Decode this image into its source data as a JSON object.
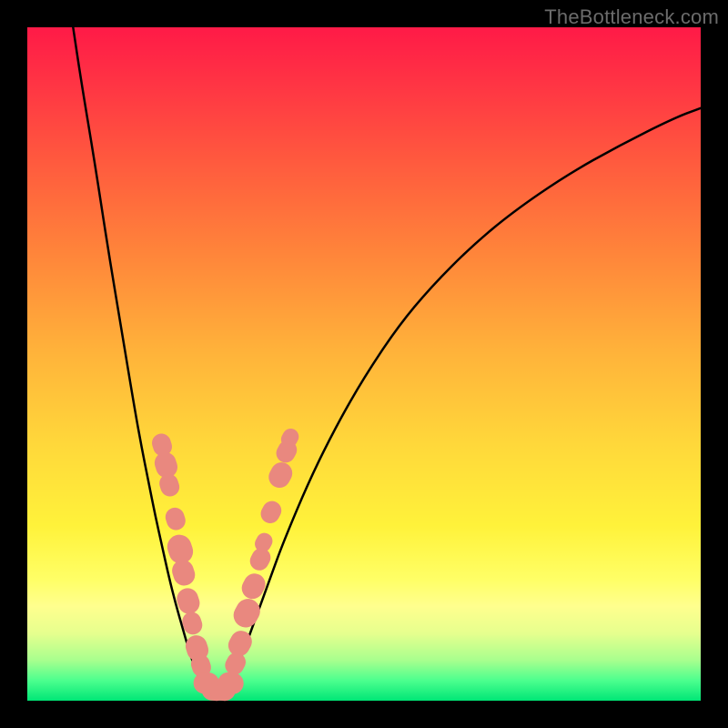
{
  "watermark": "TheBottleneck.com",
  "colors": {
    "frame": "#000000",
    "curve": "#000000",
    "marker": "#e9887f",
    "gradient_stops": [
      "#ff1a47",
      "#ff3344",
      "#ff5a3e",
      "#ff863a",
      "#ffb23a",
      "#ffd83a",
      "#fff23a",
      "#ffff66",
      "#ffff8e",
      "#e6ff8e",
      "#a8ff8e",
      "#4cff8e",
      "#00e676"
    ]
  },
  "chart_data": {
    "type": "line",
    "title": "",
    "xlabel": "",
    "ylabel": "",
    "xlim": [
      0,
      100
    ],
    "ylim": [
      0,
      100
    ],
    "grid": false,
    "legend": false,
    "series": [
      {
        "name": "left-branch",
        "x": [
          6.8,
          8,
          10,
          12,
          14,
          16,
          17,
          18,
          19,
          20,
          21,
          22,
          23,
          24,
          25,
          26
        ],
        "y": [
          100,
          92,
          80,
          67,
          55,
          43,
          37.5,
          32.5,
          27.5,
          23,
          18.5,
          14.5,
          11,
          7.5,
          4.5,
          2.2
        ]
      },
      {
        "name": "valley-floor",
        "x": [
          26,
          27,
          28,
          29,
          30
        ],
        "y": [
          2.2,
          1.2,
          0.8,
          1.2,
          2.2
        ]
      },
      {
        "name": "right-branch",
        "x": [
          30,
          32,
          34,
          36,
          38,
          42,
          46,
          50,
          55,
          60,
          66,
          72,
          80,
          88,
          96,
          100
        ],
        "y": [
          2.2,
          7,
          12.5,
          18,
          23.5,
          33,
          41,
          48,
          55.5,
          61.5,
          67.5,
          72.5,
          78,
          82.5,
          86.5,
          88
        ]
      }
    ],
    "markers_left": [
      {
        "x": 20.0,
        "y": 38.0,
        "r": 1.4
      },
      {
        "x": 20.6,
        "y": 35.0,
        "r": 1.6
      },
      {
        "x": 21.1,
        "y": 32.0,
        "r": 1.4
      },
      {
        "x": 22.0,
        "y": 27.0,
        "r": 1.4
      },
      {
        "x": 22.7,
        "y": 22.5,
        "r": 1.8
      },
      {
        "x": 23.2,
        "y": 19.0,
        "r": 1.6
      },
      {
        "x": 23.9,
        "y": 14.8,
        "r": 1.6
      },
      {
        "x": 24.5,
        "y": 11.5,
        "r": 1.4
      },
      {
        "x": 25.2,
        "y": 7.8,
        "r": 1.6
      },
      {
        "x": 25.8,
        "y": 5.2,
        "r": 1.4
      }
    ],
    "markers_floor": [
      {
        "x": 26.6,
        "y": 2.6,
        "r": 1.6
      },
      {
        "x": 27.8,
        "y": 1.6,
        "r": 1.6
      },
      {
        "x": 29.0,
        "y": 1.6,
        "r": 1.6
      },
      {
        "x": 30.2,
        "y": 2.6,
        "r": 1.6
      }
    ],
    "markers_right": [
      {
        "x": 30.9,
        "y": 5.5,
        "r": 1.4
      },
      {
        "x": 31.6,
        "y": 8.5,
        "r": 1.6
      },
      {
        "x": 32.6,
        "y": 13.0,
        "r": 1.8
      },
      {
        "x": 33.6,
        "y": 17.0,
        "r": 1.6
      },
      {
        "x": 34.6,
        "y": 21.0,
        "r": 1.4
      },
      {
        "x": 35.1,
        "y": 23.5,
        "r": 1.2
      },
      {
        "x": 36.2,
        "y": 28.0,
        "r": 1.4
      },
      {
        "x": 37.6,
        "y": 33.5,
        "r": 1.6
      },
      {
        "x": 38.5,
        "y": 37.0,
        "r": 1.4
      },
      {
        "x": 39.0,
        "y": 39.0,
        "r": 1.2
      }
    ]
  }
}
